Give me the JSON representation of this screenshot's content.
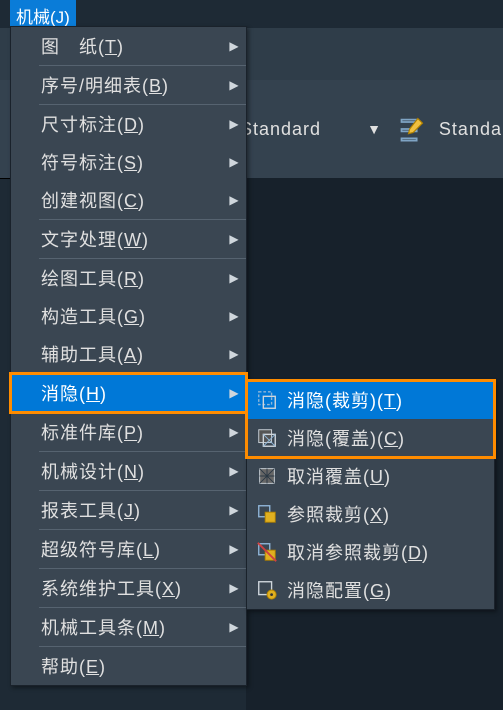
{
  "colors": {
    "highlight": "#0078d7",
    "orange": "#ff8c00",
    "menu_bg": "#3a4652",
    "bg": "#1e2a35"
  },
  "menu_trigger": {
    "label": "机械(J)"
  },
  "ribbon": {
    "combo_value": "Standard",
    "combo_value_2": "Standa"
  },
  "main_menu": [
    {
      "label": "图　纸(T)",
      "has_sub": true
    },
    {
      "sep": true
    },
    {
      "label": "序号/明细表(B)",
      "has_sub": true
    },
    {
      "sep": true
    },
    {
      "label": "尺寸标注(D)",
      "has_sub": true
    },
    {
      "label": "符号标注(S)",
      "has_sub": true
    },
    {
      "label": "创建视图(C)",
      "has_sub": true
    },
    {
      "sep": true
    },
    {
      "label": "文字处理(W)",
      "has_sub": true
    },
    {
      "sep": true
    },
    {
      "label": "绘图工具(R)",
      "has_sub": true
    },
    {
      "label": "构造工具(G)",
      "has_sub": true
    },
    {
      "label": "辅助工具(A)",
      "has_sub": true
    },
    {
      "sep": true
    },
    {
      "label": "消隐(H)",
      "has_sub": true,
      "highlight": true,
      "orange": true
    },
    {
      "sep": true
    },
    {
      "label": "标准件库(P)",
      "has_sub": true
    },
    {
      "sep": true
    },
    {
      "label": "机械设计(N)",
      "has_sub": true
    },
    {
      "sep": true
    },
    {
      "label": "报表工具(J)",
      "has_sub": true
    },
    {
      "sep": true
    },
    {
      "label": "超级符号库(L)",
      "has_sub": true
    },
    {
      "sep": true
    },
    {
      "label": "系统维护工具(X)",
      "has_sub": true
    },
    {
      "sep": true
    },
    {
      "label": "机械工具条(M)",
      "has_sub": true
    },
    {
      "sep": true
    },
    {
      "label": "帮助(E)",
      "has_sub": false
    }
  ],
  "sub_menu": [
    {
      "icon": "hide-trim-icon",
      "label": "消隐(裁剪)(T)",
      "highlight": true,
      "orange": true
    },
    {
      "icon": "hide-cover-icon",
      "label": "消隐(覆盖)(C)",
      "orange": true
    },
    {
      "icon": "uncover-icon",
      "label": "取消覆盖(U)"
    },
    {
      "icon": "ref-trim-icon",
      "label": "参照裁剪(X)"
    },
    {
      "icon": "cancel-ref-trim-icon",
      "label": "取消参照裁剪(D)"
    },
    {
      "icon": "hide-config-icon",
      "label": "消隐配置(G)"
    }
  ]
}
